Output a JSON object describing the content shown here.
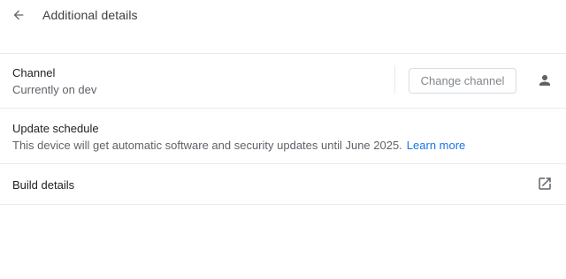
{
  "header": {
    "title": "Additional details",
    "back_icon": "arrow-back-icon"
  },
  "channel": {
    "label": "Channel",
    "value": "Currently on dev",
    "button_label": "Change channel",
    "button_disabled": true,
    "managed_icon": "person-icon"
  },
  "update_schedule": {
    "label": "Update schedule",
    "text": "This device will get automatic software and security updates until June 2025.",
    "link_label": "Learn more",
    "link_color": "#1a73e8"
  },
  "build_details": {
    "label": "Build details",
    "open_icon": "open-in-new-icon"
  }
}
